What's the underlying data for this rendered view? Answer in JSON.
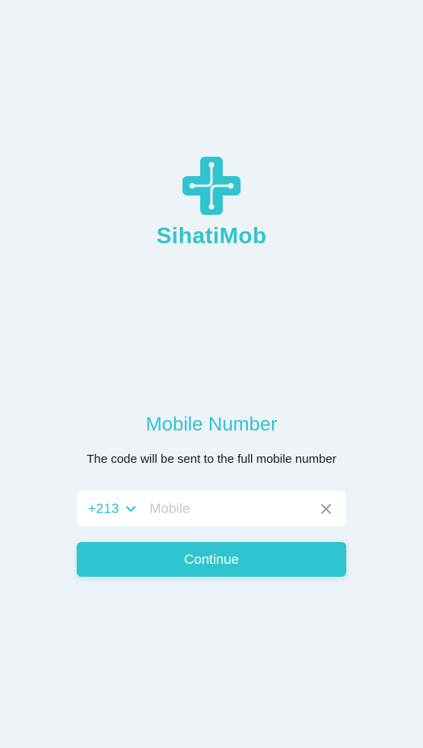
{
  "app": {
    "brand_name": "SihatiMob",
    "logo_icon": "medical-cross-icon"
  },
  "colors": {
    "accent": "#2fc4cf",
    "background": "#eef3f8",
    "text": "#1b1b1b",
    "placeholder": "#c3c8cc"
  },
  "login": {
    "title": "Mobile Number",
    "subtitle": "The code will be sent to the full mobile number",
    "country_code": "+213",
    "country_icon": "chevron-down-icon",
    "mobile_placeholder": "Mobile",
    "mobile_value": "",
    "clear_icon": "close-icon",
    "continue_label": "Continue"
  }
}
